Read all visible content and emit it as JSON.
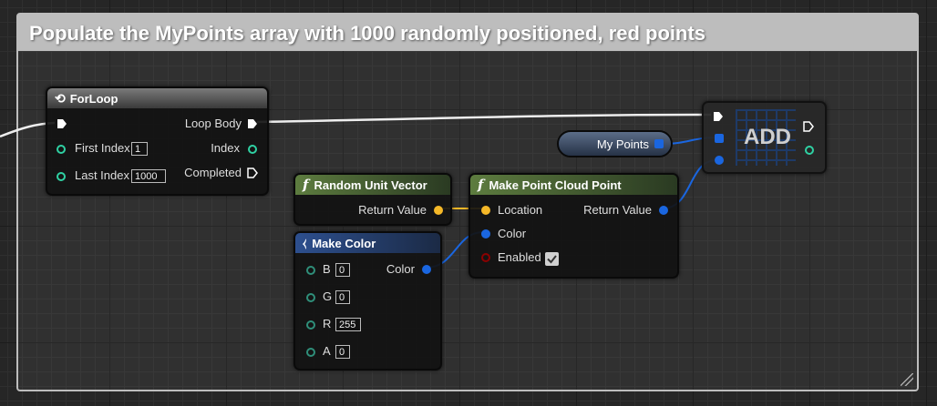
{
  "comment": {
    "title": "Populate the MyPoints array with 1000 randomly positioned, red points"
  },
  "colors": {
    "exec": "#ffffff",
    "int": "#2fd1a3",
    "struct_vector": "#f5b828",
    "struct_color": "#1a66e0",
    "bool": "#8b0000"
  },
  "nodes": {
    "forloop": {
      "title": "ForLoop",
      "icon": "loop-icon",
      "first_index_label": "First Index",
      "first_index_value": "1",
      "last_index_label": "Last Index",
      "last_index_value": "1000",
      "loop_body_label": "Loop Body",
      "index_label": "Index",
      "completed_label": "Completed"
    },
    "my_points": {
      "label": "My Points"
    },
    "add": {
      "label": "ADD"
    },
    "random_unit_vector": {
      "title": "Random Unit Vector",
      "icon": "function-icon",
      "return_label": "Return Value"
    },
    "make_point_cloud_point": {
      "title": "Make Point Cloud Point",
      "icon": "function-icon",
      "location_label": "Location",
      "color_label": "Color",
      "enabled_label": "Enabled",
      "enabled_checked": true,
      "return_label": "Return Value"
    },
    "make_color": {
      "title": "Make Color",
      "icon": "make-struct-icon",
      "b_label": "B",
      "b_value": "0",
      "g_label": "G",
      "g_value": "0",
      "r_label": "R",
      "r_value": "255",
      "a_label": "A",
      "a_value": "0",
      "color_label": "Color"
    }
  }
}
